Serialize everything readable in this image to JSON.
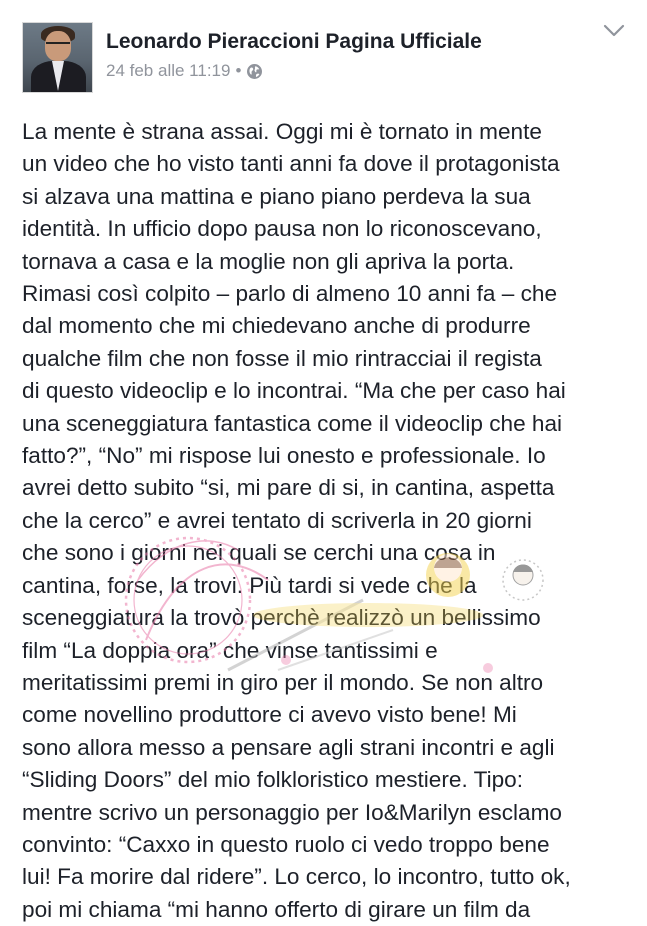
{
  "post": {
    "author": "Leonardo Pieraccioni Pagina Ufficiale",
    "timestamp": "24 feb alle 11:19",
    "separator": "•",
    "privacy_icon": "globe-icon",
    "menu_icon": "chevron-down-icon",
    "body_lines": [
      "La mente è strana assai. Oggi mi è tornato in mente",
      "un video che ho visto tanti anni fa dove il protagonista",
      "si alzava una mattina e piano piano perdeva la sua",
      "identità. In ufficio dopo pausa non lo riconoscevano,",
      "tornava a casa e la moglie non gli apriva la porta.",
      "Rimasi così colpito – parlo di almeno 10 anni fa – che",
      "dal momento che mi chiedevano anche di produrre",
      "qualche film che non fosse il mio rintracciai il regista",
      "di questo videoclip e lo incontrai. “Ma che per caso hai",
      "una sceneggiatura fantastica come il videoclip che hai",
      "fatto?”, “No” mi rispose lui onesto e professionale. Io",
      "avrei detto subito “si, mi pare di si, in cantina, aspetta",
      "che la cerco” e avrei tentato di scriverla in 20 giorni",
      "che sono i giorni nei quali se cerchi una cosa in",
      "cantina, forse, la trovi. Più tardi si vede che la",
      "sceneggiatura la trovò perchè realizzò un bellissimo",
      "film “La doppia ora” che vinse tantissimi e",
      "meritatissimi premi in giro per il mondo. Se non altro",
      "come novellino produttore ci avevo visto bene! Mi",
      "sono allora messo a pensare agli strani incontri e agli",
      "“Sliding Doors” del mio folkloristico mestiere. Tipo:",
      "mentre scrivo un personaggio per Io&Marilyn esclamo",
      "convinto: “Caxxo in questo ruolo ci vedo troppo bene",
      "lui! Fa morire dal ridere”. Lo cerco, lo incontro, tutto ok,",
      "poi mi chiama “mi hanno offerto di girare un film da"
    ]
  },
  "colors": {
    "text": "#1d2129",
    "meta": "#90949c",
    "background": "#ffffff",
    "watermark_pink": "#e87aa8",
    "watermark_yellow": "#f3d24a"
  }
}
